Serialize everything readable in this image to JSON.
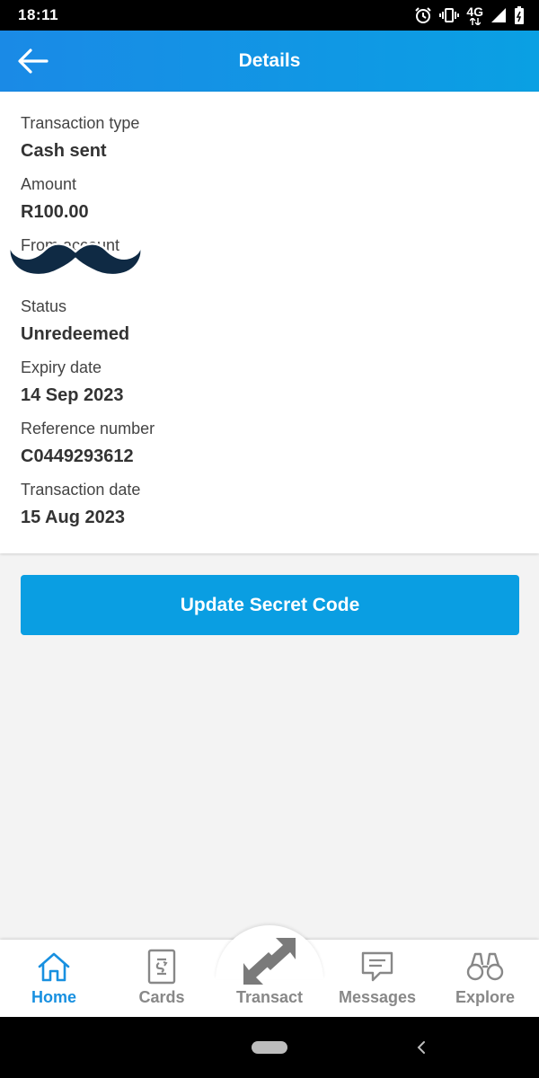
{
  "status_bar": {
    "time": "18:11",
    "network": "4G",
    "icons": [
      "alarm-icon",
      "vibrate-icon",
      "network-4g-icon",
      "signal-icon",
      "battery-icon"
    ]
  },
  "app_bar": {
    "title": "Details",
    "back_icon": "arrow-left-icon"
  },
  "details": [
    {
      "label": "Transaction type",
      "value": "Cash sent"
    },
    {
      "label": "Amount",
      "value": "R100.00"
    },
    {
      "label": "From account",
      "value": "",
      "redacted": true
    },
    {
      "label": "Status",
      "value": "Unredeemed"
    },
    {
      "label": "Expiry date",
      "value": "14 Sep 2023"
    },
    {
      "label": "Reference number",
      "value": "C0449293612"
    },
    {
      "label": "Transaction date",
      "value": "15 Aug 2023"
    }
  ],
  "primary_action": {
    "label": "Update Secret Code"
  },
  "bottom_nav": {
    "active": "Home",
    "items": [
      {
        "label": "Home",
        "icon": "home-icon"
      },
      {
        "label": "Cards",
        "icon": "card-icon"
      },
      {
        "label": "Transact",
        "icon": "transfer-arrows-icon"
      },
      {
        "label": "Messages",
        "icon": "message-icon"
      },
      {
        "label": "Explore",
        "icon": "binoculars-icon"
      }
    ]
  },
  "colors": {
    "brand_blue": "#0a9ee2",
    "active_nav": "#1890e0",
    "inactive_nav": "#888888"
  }
}
